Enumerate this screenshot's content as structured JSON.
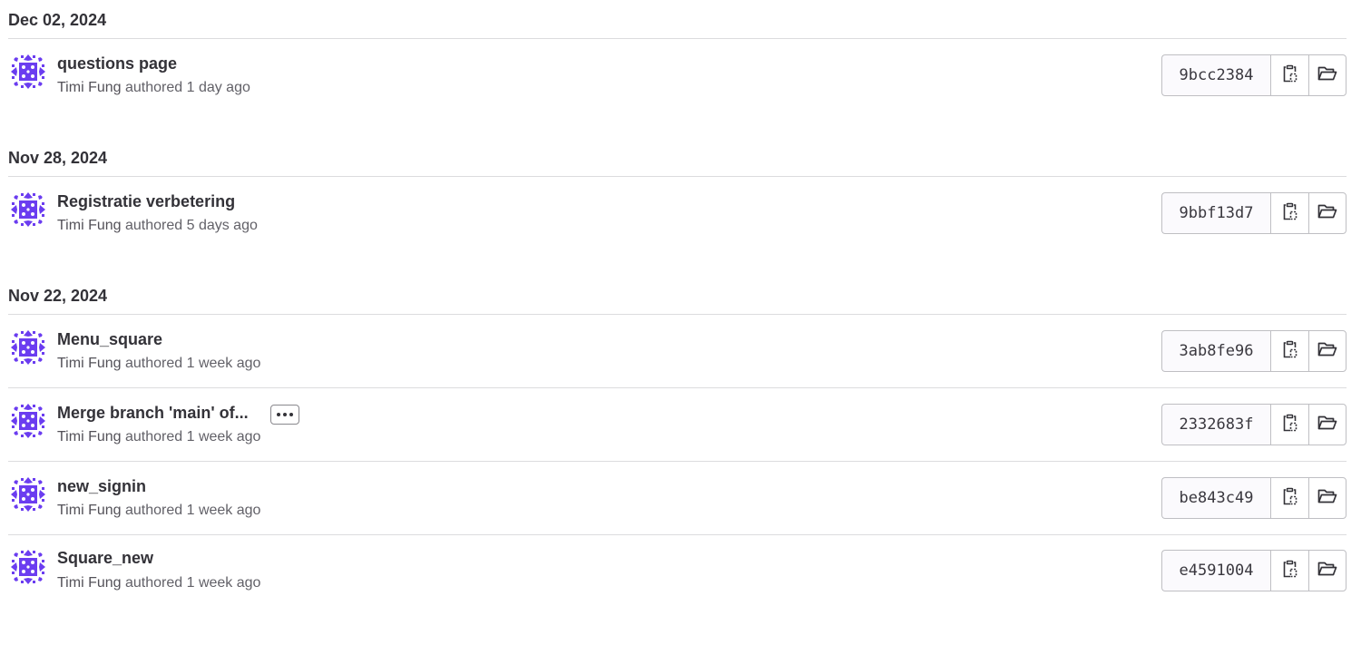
{
  "colors": {
    "avatar_primary": "#6b3df0",
    "avatar_bg": "#ffffff"
  },
  "icons": {
    "copy": "copy-to-clipboard-icon",
    "browse": "folder-open-icon",
    "more": "ellipsis-icon",
    "avatar": "identicon-avatar"
  },
  "groups": [
    {
      "date": "Dec 02, 2024",
      "commits": [
        {
          "title": "questions page",
          "author": "Timi Fung",
          "authored_text": "authored 1 day ago",
          "sha": "9bcc2384"
        }
      ]
    },
    {
      "date": "Nov 28, 2024",
      "commits": [
        {
          "title": "Registratie verbetering",
          "author": "Timi Fung",
          "authored_text": "authored 5 days ago",
          "sha": "9bbf13d7"
        }
      ]
    },
    {
      "date": "Nov 22, 2024",
      "commits": [
        {
          "title": "Menu_square",
          "author": "Timi Fung",
          "authored_text": "authored 1 week ago",
          "sha": "3ab8fe96"
        },
        {
          "title": "Merge branch 'main' of...",
          "author": "Timi Fung",
          "authored_text": "authored 1 week ago",
          "sha": "2332683f"
        },
        {
          "title": "new_signin",
          "author": "Timi Fung",
          "authored_text": "authored 1 week ago",
          "sha": "be843c49"
        },
        {
          "title": "Square_new",
          "author": "Timi Fung",
          "authored_text": "authored 1 week ago",
          "sha": "e4591004"
        }
      ]
    }
  ]
}
